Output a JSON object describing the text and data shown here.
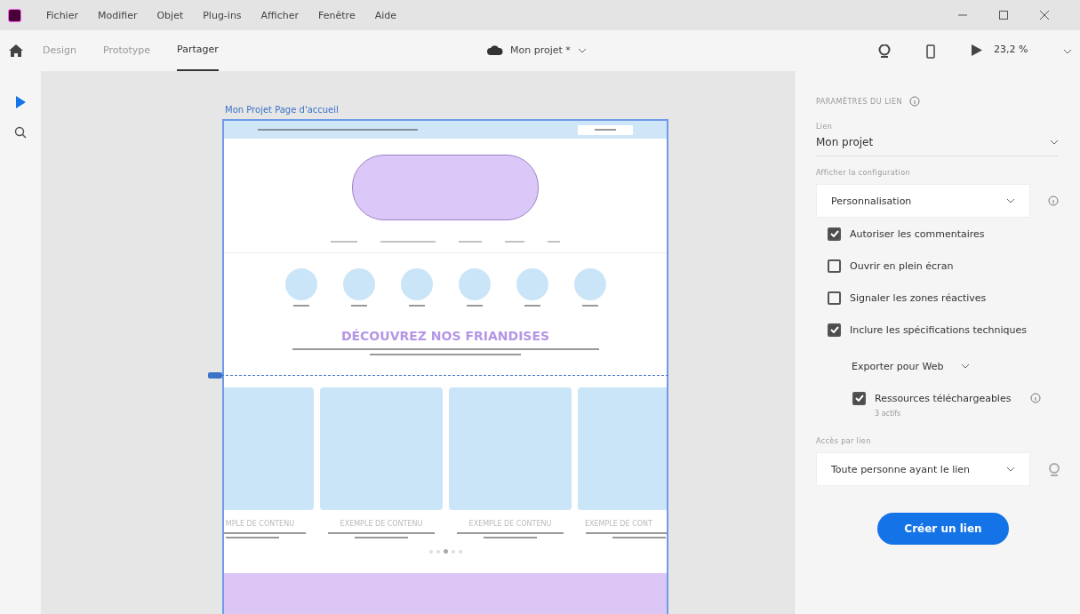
{
  "menu_bar": {
    "items": [
      "Fichier",
      "Modifier",
      "Objet",
      "Plug-ins",
      "Afficher",
      "Fenêtre",
      "Aide"
    ]
  },
  "toolbar": {
    "tabs": [
      {
        "label": "Design",
        "selected": false
      },
      {
        "label": "Prototype",
        "selected": false
      },
      {
        "label": "Partager",
        "selected": true
      }
    ],
    "document": "Mon projet *",
    "zoom": "23,2 %"
  },
  "canvas": {
    "artboard_title": "Mon Projet Page d'accueil",
    "heading": "DÉCOUVREZ NOS FRIANDISES",
    "cards": [
      {
        "title": "MPLE DE CONTENU"
      },
      {
        "title": "EXEMPLE DE CONTENU"
      },
      {
        "title": "EXEMPLE DE CONTENU"
      },
      {
        "title": "EXEMPLE DE CONT"
      }
    ]
  },
  "panel": {
    "title": "PARAMÈTRES DU LIEN",
    "link_label": "Lien",
    "link_value": "Mon projet",
    "config_label": "Afficher la configuration",
    "config_value": "Personnalisation",
    "options": [
      {
        "label": "Autoriser les commentaires",
        "checked": true
      },
      {
        "label": "Ouvrir en plein écran",
        "checked": false
      },
      {
        "label": "Signaler les zones réactives",
        "checked": false
      },
      {
        "label": "Inclure les spécifications techniques",
        "checked": true
      }
    ],
    "export_value": "Exporter pour Web",
    "resources": {
      "label": "Ressources téléchargeables",
      "checked": true,
      "note": "3 actifs"
    },
    "access_label": "Accès par lien",
    "access_value": "Toute personne ayant le lien",
    "create_button": "Créer un lien"
  }
}
